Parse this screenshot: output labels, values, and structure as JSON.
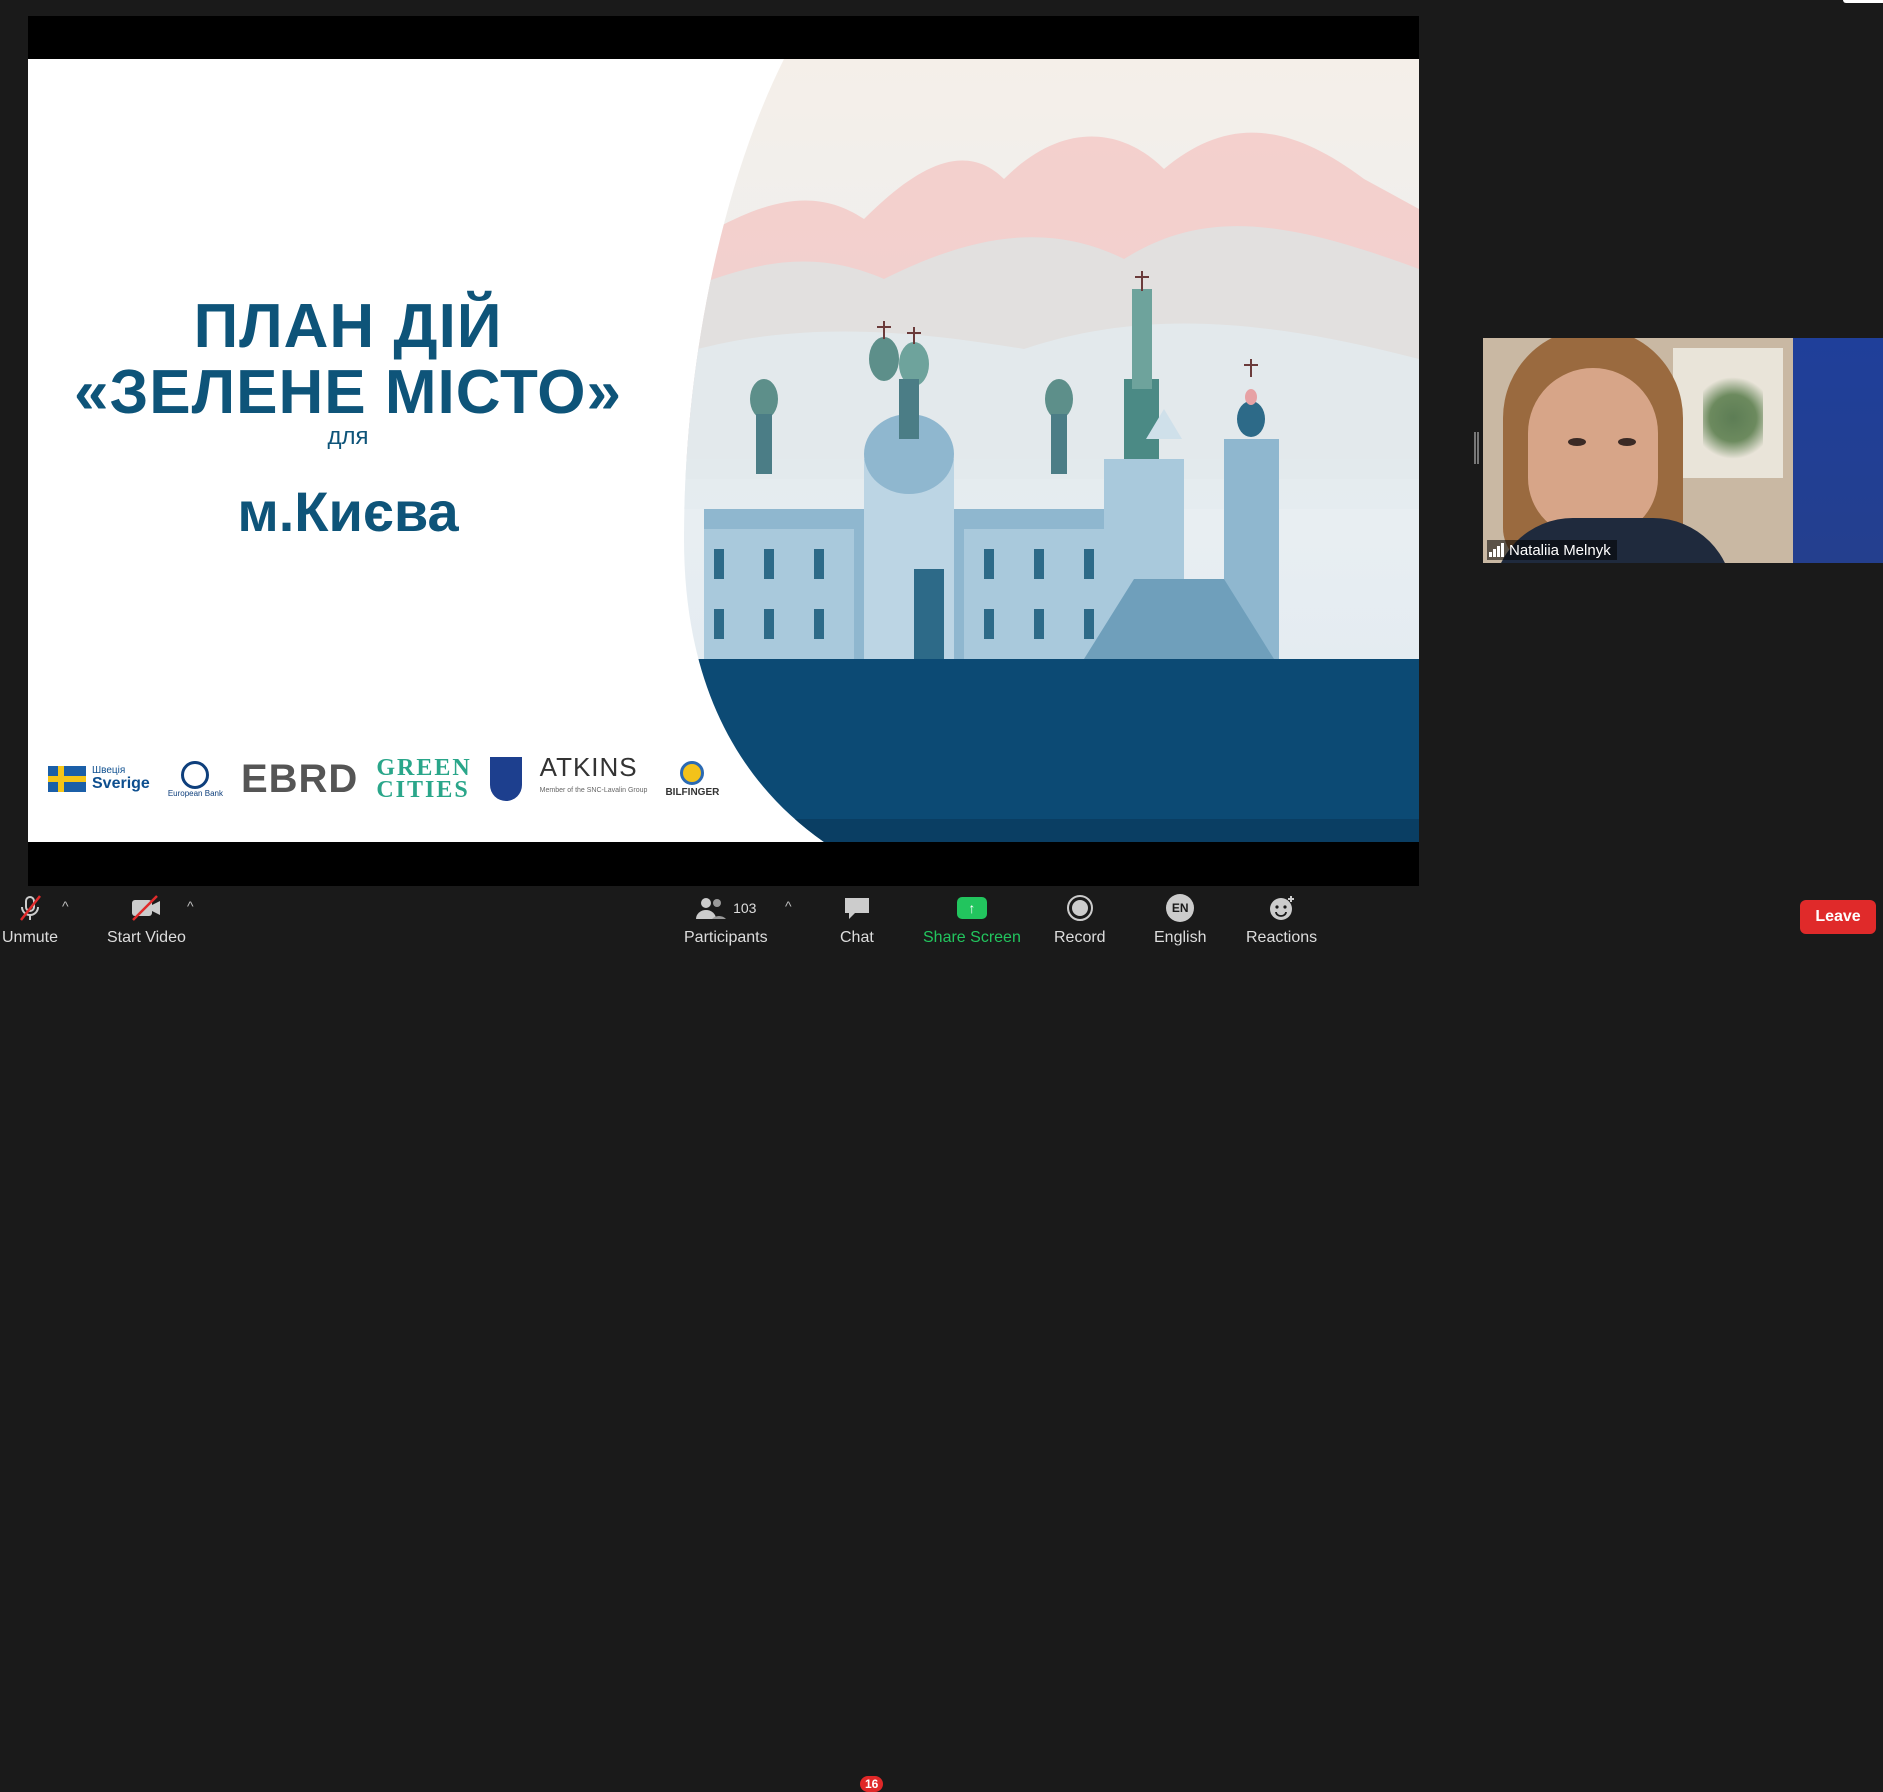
{
  "slide": {
    "title_line1": "ПЛАН ДІЙ",
    "title_line2": "«ЗЕЛЕНЕ МІСТО»",
    "title_line3": "для",
    "title_line4": "м.Києва",
    "logos": {
      "sweden_small": "Швеція",
      "sweden_big": "Sverige",
      "eb_text": "European Bank",
      "ebrd": "EBRD",
      "green_line1": "GREEN",
      "green_line2": "CITIES",
      "atkins": "ATKINS",
      "atkins_sub": "Member of the SNC-Lavalin Group",
      "bilfinger": "BILFINGER"
    }
  },
  "participant": {
    "name": "Nataliia Melnyk"
  },
  "toolbar": {
    "unmute": "Unmute",
    "start_video": "Start Video",
    "participants_label": "Participants",
    "participants_count": "103",
    "chat_label": "Chat",
    "chat_badge": "16",
    "share_label": "Share Screen",
    "record_label": "Record",
    "language_badge": "EN",
    "language_label": "English",
    "reactions_label": "Reactions",
    "leave_label": "Leave"
  },
  "colors": {
    "title_blue": "#0e5479",
    "share_green": "#22c55e",
    "leave_red": "#e02a2a",
    "toolbar_bg": "#1a1a1a"
  }
}
